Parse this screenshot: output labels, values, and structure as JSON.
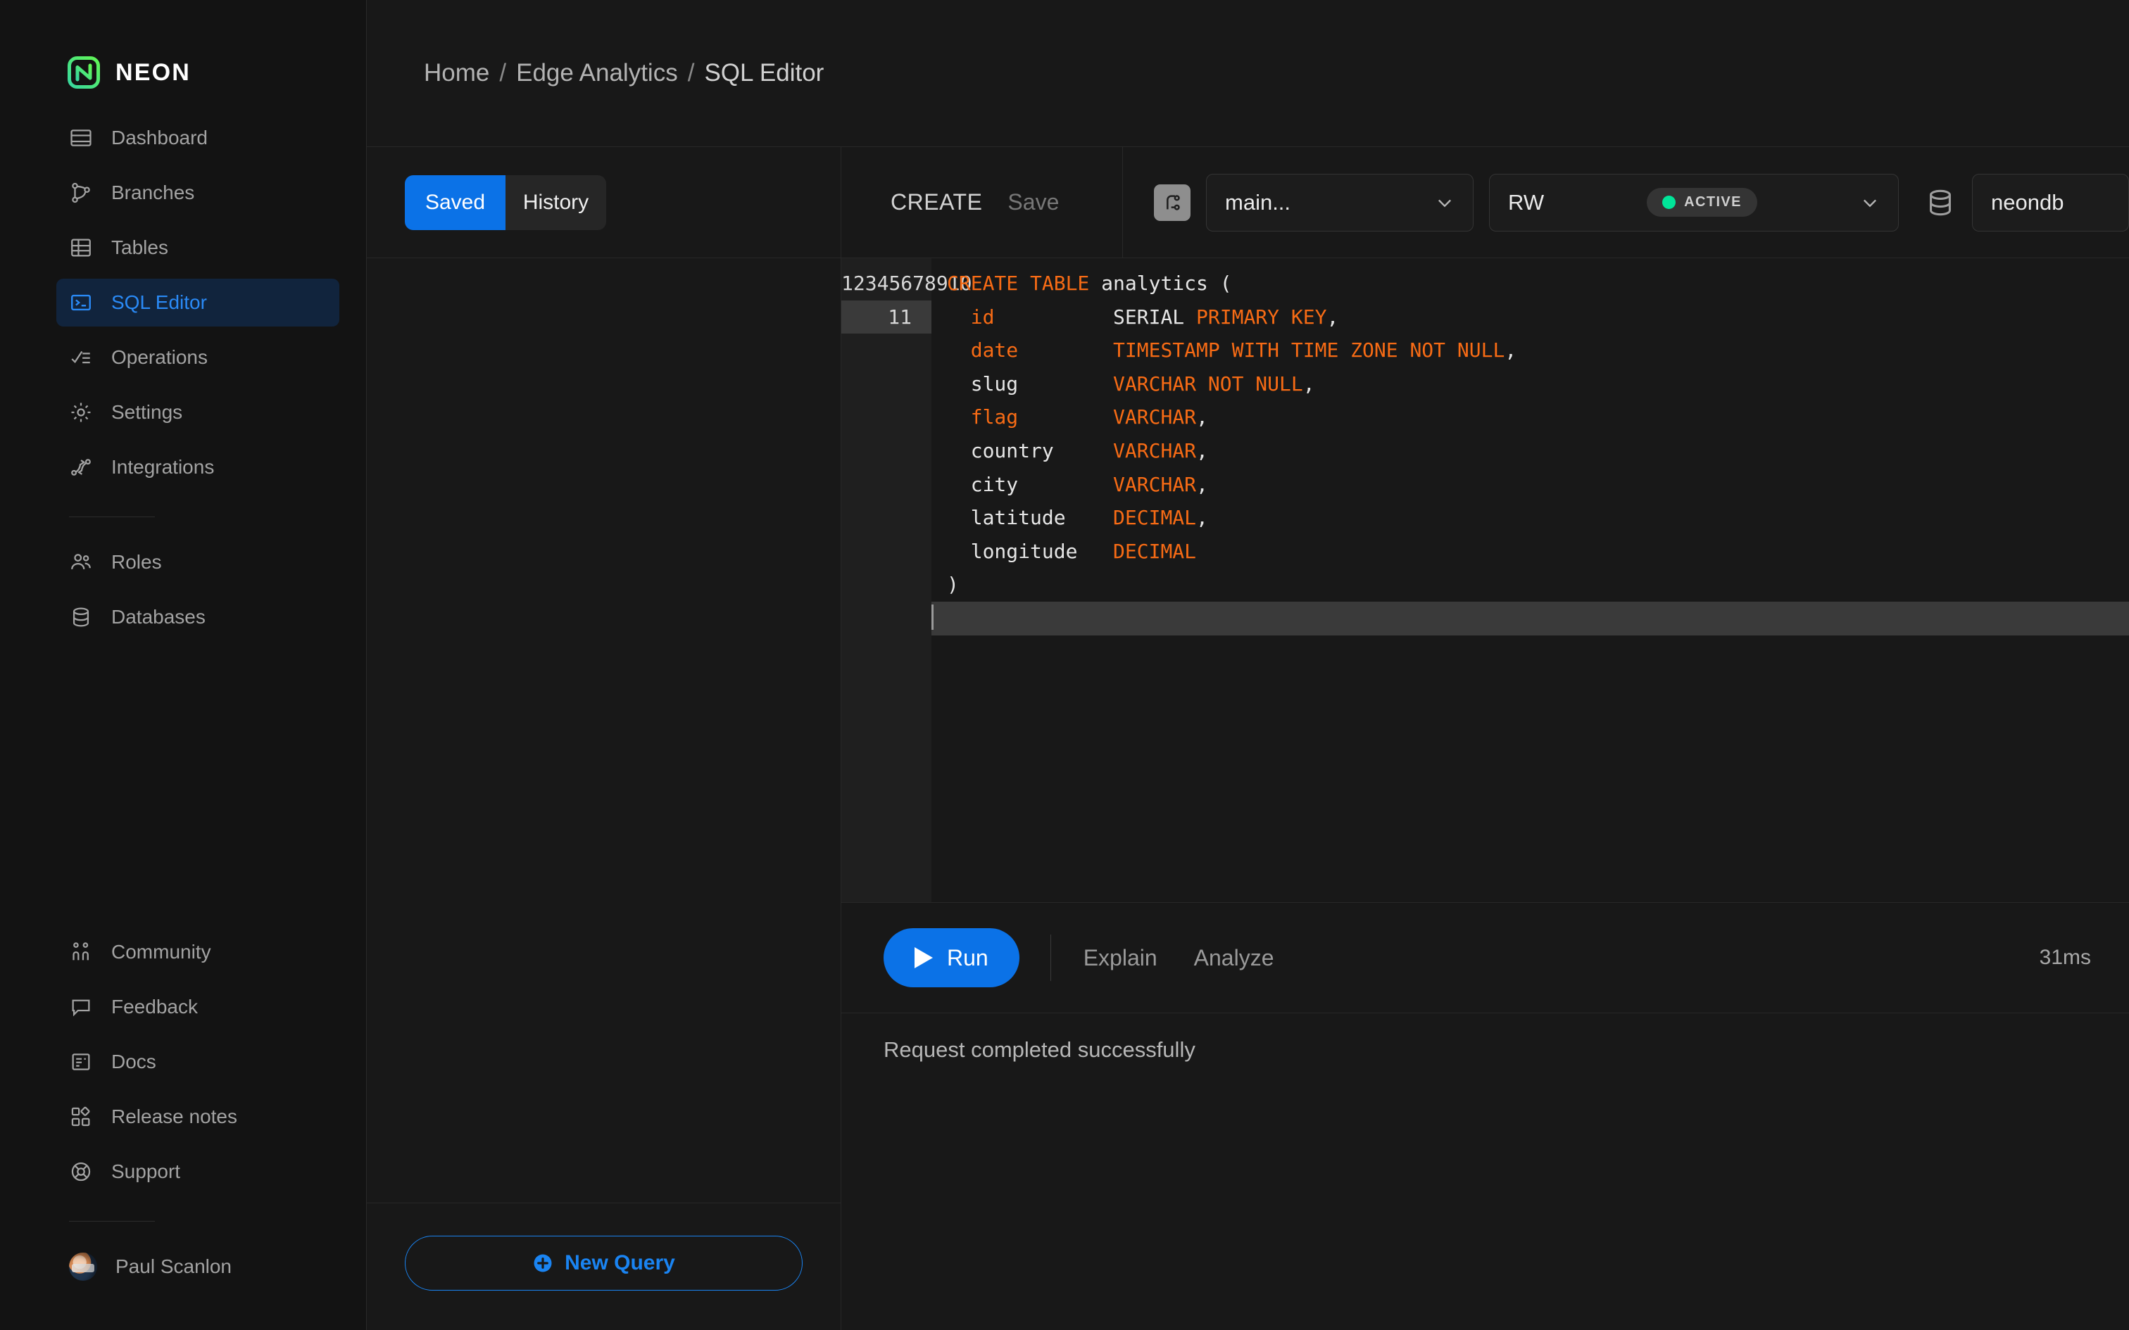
{
  "brand": {
    "name": "NEON",
    "logo_icon": "neon-logo-icon"
  },
  "sidebar": {
    "primary": [
      {
        "label": "Dashboard",
        "icon": "dashboard-icon",
        "active": false
      },
      {
        "label": "Branches",
        "icon": "branches-icon",
        "active": false
      },
      {
        "label": "Tables",
        "icon": "tables-icon",
        "active": false
      },
      {
        "label": "SQL Editor",
        "icon": "sql-editor-icon",
        "active": true
      },
      {
        "label": "Operations",
        "icon": "operations-icon",
        "active": false
      },
      {
        "label": "Settings",
        "icon": "gear-icon",
        "active": false
      },
      {
        "label": "Integrations",
        "icon": "integrations-icon",
        "active": false
      }
    ],
    "secondary": [
      {
        "label": "Roles",
        "icon": "users-icon"
      },
      {
        "label": "Databases",
        "icon": "database-icon"
      }
    ],
    "support": [
      {
        "label": "Community",
        "icon": "community-icon"
      },
      {
        "label": "Feedback",
        "icon": "speech-bubble-icon"
      },
      {
        "label": "Docs",
        "icon": "docs-icon"
      },
      {
        "label": "Release notes",
        "icon": "release-notes-icon"
      },
      {
        "label": "Support",
        "icon": "lifebuoy-icon"
      }
    ],
    "user": {
      "name": "Paul Scanlon",
      "avatar_icon": "avatar"
    }
  },
  "breadcrumb": {
    "home": "Home",
    "project": "Edge Analytics",
    "page": "SQL Editor",
    "separator": "/"
  },
  "query_panel": {
    "tabs": [
      {
        "label": "Saved",
        "active": true
      },
      {
        "label": "History",
        "active": false
      }
    ],
    "new_query_label": "New Query",
    "new_query_icon": "plus-circle-icon"
  },
  "editor_toolbar": {
    "query_title": "CREATE",
    "save_label": "Save",
    "branch_icon": "branch-icon",
    "branch_value": "main...",
    "compute_value": "RW",
    "compute_status": "ACTIVE",
    "status_color": "#00e599",
    "database_icon": "database-icon",
    "database_value": "neondb",
    "chevron_icon": "chevron-down-icon"
  },
  "editor": {
    "active_line": 11,
    "line_numbers": [
      "1",
      "2",
      "3",
      "4",
      "5",
      "6",
      "7",
      "8",
      "9",
      "10",
      "11"
    ],
    "lines": [
      [
        {
          "t": "CREATE TABLE",
          "k": true
        },
        {
          "t": " analytics (",
          "k": false
        }
      ],
      [
        {
          "t": "  ",
          "k": false
        },
        {
          "t": "id",
          "k": true
        },
        {
          "t": "          SERIAL ",
          "k": false
        },
        {
          "t": "PRIMARY KEY",
          "k": true
        },
        {
          "t": ",",
          "k": false
        }
      ],
      [
        {
          "t": "  ",
          "k": false
        },
        {
          "t": "date",
          "k": true
        },
        {
          "t": "        ",
          "k": false
        },
        {
          "t": "TIMESTAMP WITH TIME ZONE NOT NULL",
          "k": true
        },
        {
          "t": ",",
          "k": false
        }
      ],
      [
        {
          "t": "  slug        ",
          "k": false
        },
        {
          "t": "VARCHAR NOT NULL",
          "k": true
        },
        {
          "t": ",",
          "k": false
        }
      ],
      [
        {
          "t": "  ",
          "k": false
        },
        {
          "t": "flag",
          "k": true
        },
        {
          "t": "        ",
          "k": false
        },
        {
          "t": "VARCHAR",
          "k": true
        },
        {
          "t": ",",
          "k": false
        }
      ],
      [
        {
          "t": "  country     ",
          "k": false
        },
        {
          "t": "VARCHAR",
          "k": true
        },
        {
          "t": ",",
          "k": false
        }
      ],
      [
        {
          "t": "  city        ",
          "k": false
        },
        {
          "t": "VARCHAR",
          "k": true
        },
        {
          "t": ",",
          "k": false
        }
      ],
      [
        {
          "t": "  latitude    ",
          "k": false
        },
        {
          "t": "DECIMAL",
          "k": true
        },
        {
          "t": ",",
          "k": false
        }
      ],
      [
        {
          "t": "  longitude   ",
          "k": false
        },
        {
          "t": "DECIMAL",
          "k": true
        }
      ],
      [
        {
          "t": ")",
          "k": false
        }
      ],
      []
    ]
  },
  "run_bar": {
    "run_label": "Run",
    "run_icon": "play-icon",
    "explain_label": "Explain",
    "analyze_label": "Analyze",
    "timing": "31ms"
  },
  "result": {
    "message": "Request completed successfully"
  },
  "colors": {
    "accent_blue": "#0b72e7",
    "link_blue": "#1a84f2",
    "keyword_orange": "#f76b15",
    "status_green": "#00e599",
    "sidebar_bg": "#131313",
    "main_bg": "#181818"
  }
}
